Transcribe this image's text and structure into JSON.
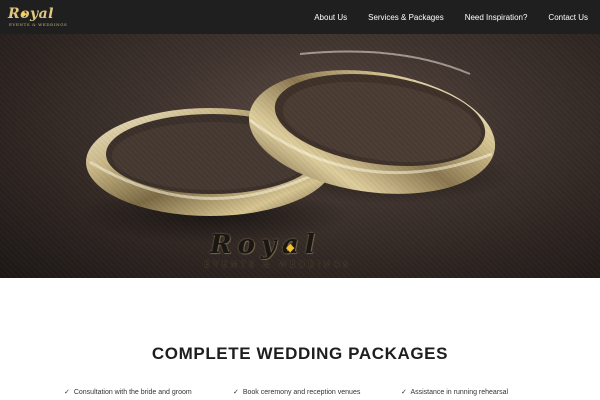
{
  "nav": {
    "logo": {
      "script": "Royal",
      "subtitle": "EVENTS & WEDDINGS"
    },
    "links": [
      "About Us",
      "Services & Packages",
      "Need Inspiration?",
      "Contact Us"
    ]
  },
  "hero": {
    "logo": {
      "script": "Royal",
      "subtitle": "EVENTS & WEDDINGS"
    }
  },
  "packages": {
    "title": "COMPLETE WEDDING PACKAGES",
    "features": [
      "Consultation with the bride and groom",
      "Book ceremony and reception venues",
      "Assistance in running rehearsal"
    ],
    "check_icon": "check-icon"
  },
  "colors": {
    "nav_bg": "#1f1f1f",
    "nav_text": "#ffffff",
    "logo_gold": "#e1c77f",
    "title_text": "#1e1e1e"
  }
}
